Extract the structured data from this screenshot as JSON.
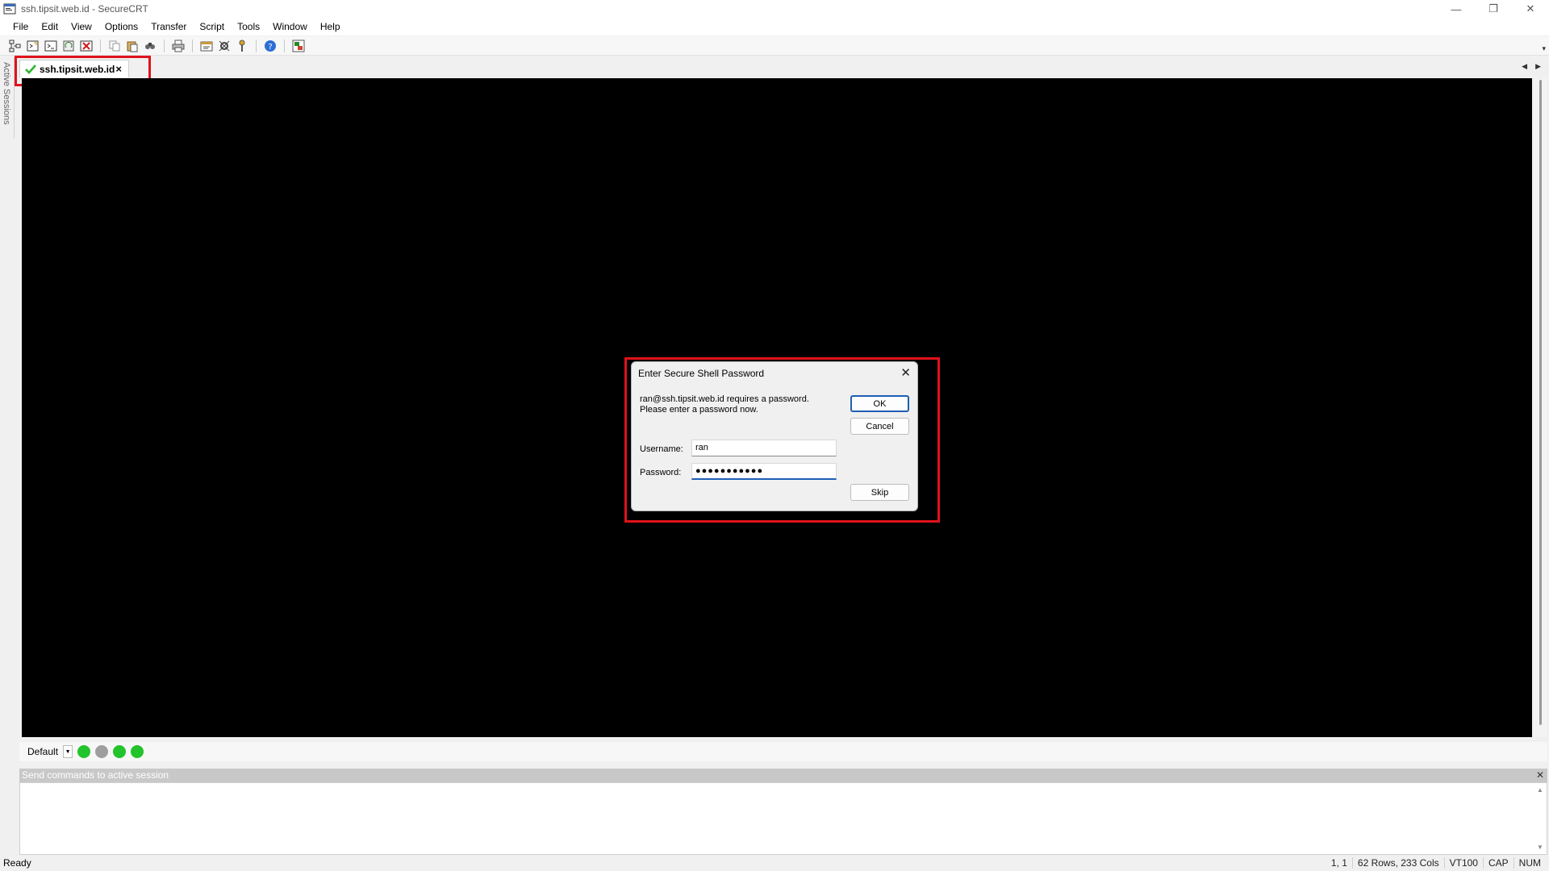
{
  "window": {
    "title": "ssh.tipsit.web.id - SecureCRT",
    "controls": [
      "minimize-icon",
      "restore-icon",
      "close-icon"
    ]
  },
  "menu": [
    "File",
    "Edit",
    "View",
    "Options",
    "Transfer",
    "Script",
    "Tools",
    "Window",
    "Help"
  ],
  "toolbar": {
    "icons": [
      "connect-icon",
      "quick-connect-icon",
      "connect-in-tab-icon",
      "reconnect-icon",
      "disconnect-icon",
      "copy-icon",
      "paste-icon",
      "find-icon",
      "print-icon",
      "session-options-icon",
      "global-options-icon",
      "keymap-icon",
      "help-icon",
      "sftp-icon"
    ]
  },
  "sidebar": {
    "label": "Active Sessions"
  },
  "tab": {
    "label": "ssh.tipsit.web.id",
    "close": "×",
    "status_color": "#2bb52b"
  },
  "dialog": {
    "title": "Enter Secure Shell Password",
    "close": "✕",
    "message_line1": "ran@ssh.tipsit.web.id requires a password.",
    "message_line2": "Please enter a password now.",
    "username_label": "Username:",
    "username_value": "ran",
    "password_label": "Password:",
    "password_value": "●●●●●●●●●●●",
    "ok": "OK",
    "cancel": "Cancel",
    "skip": "Skip"
  },
  "buttonbar": {
    "selected": "Default",
    "dots": [
      "#22c32b",
      "#9e9e9e",
      "#22c32b",
      "#22c32b"
    ]
  },
  "command_window": {
    "header": "Send commands to active session",
    "close": "✕"
  },
  "statusbar": {
    "status": "Ready",
    "position": "1,   1",
    "size": "62 Rows, 233 Cols",
    "emulation": "VT100",
    "cap": "CAP",
    "num": "NUM"
  },
  "colors": {
    "highlight": "#e0121b",
    "terminal_bg": "#000000",
    "accent": "#1f5fb4"
  }
}
